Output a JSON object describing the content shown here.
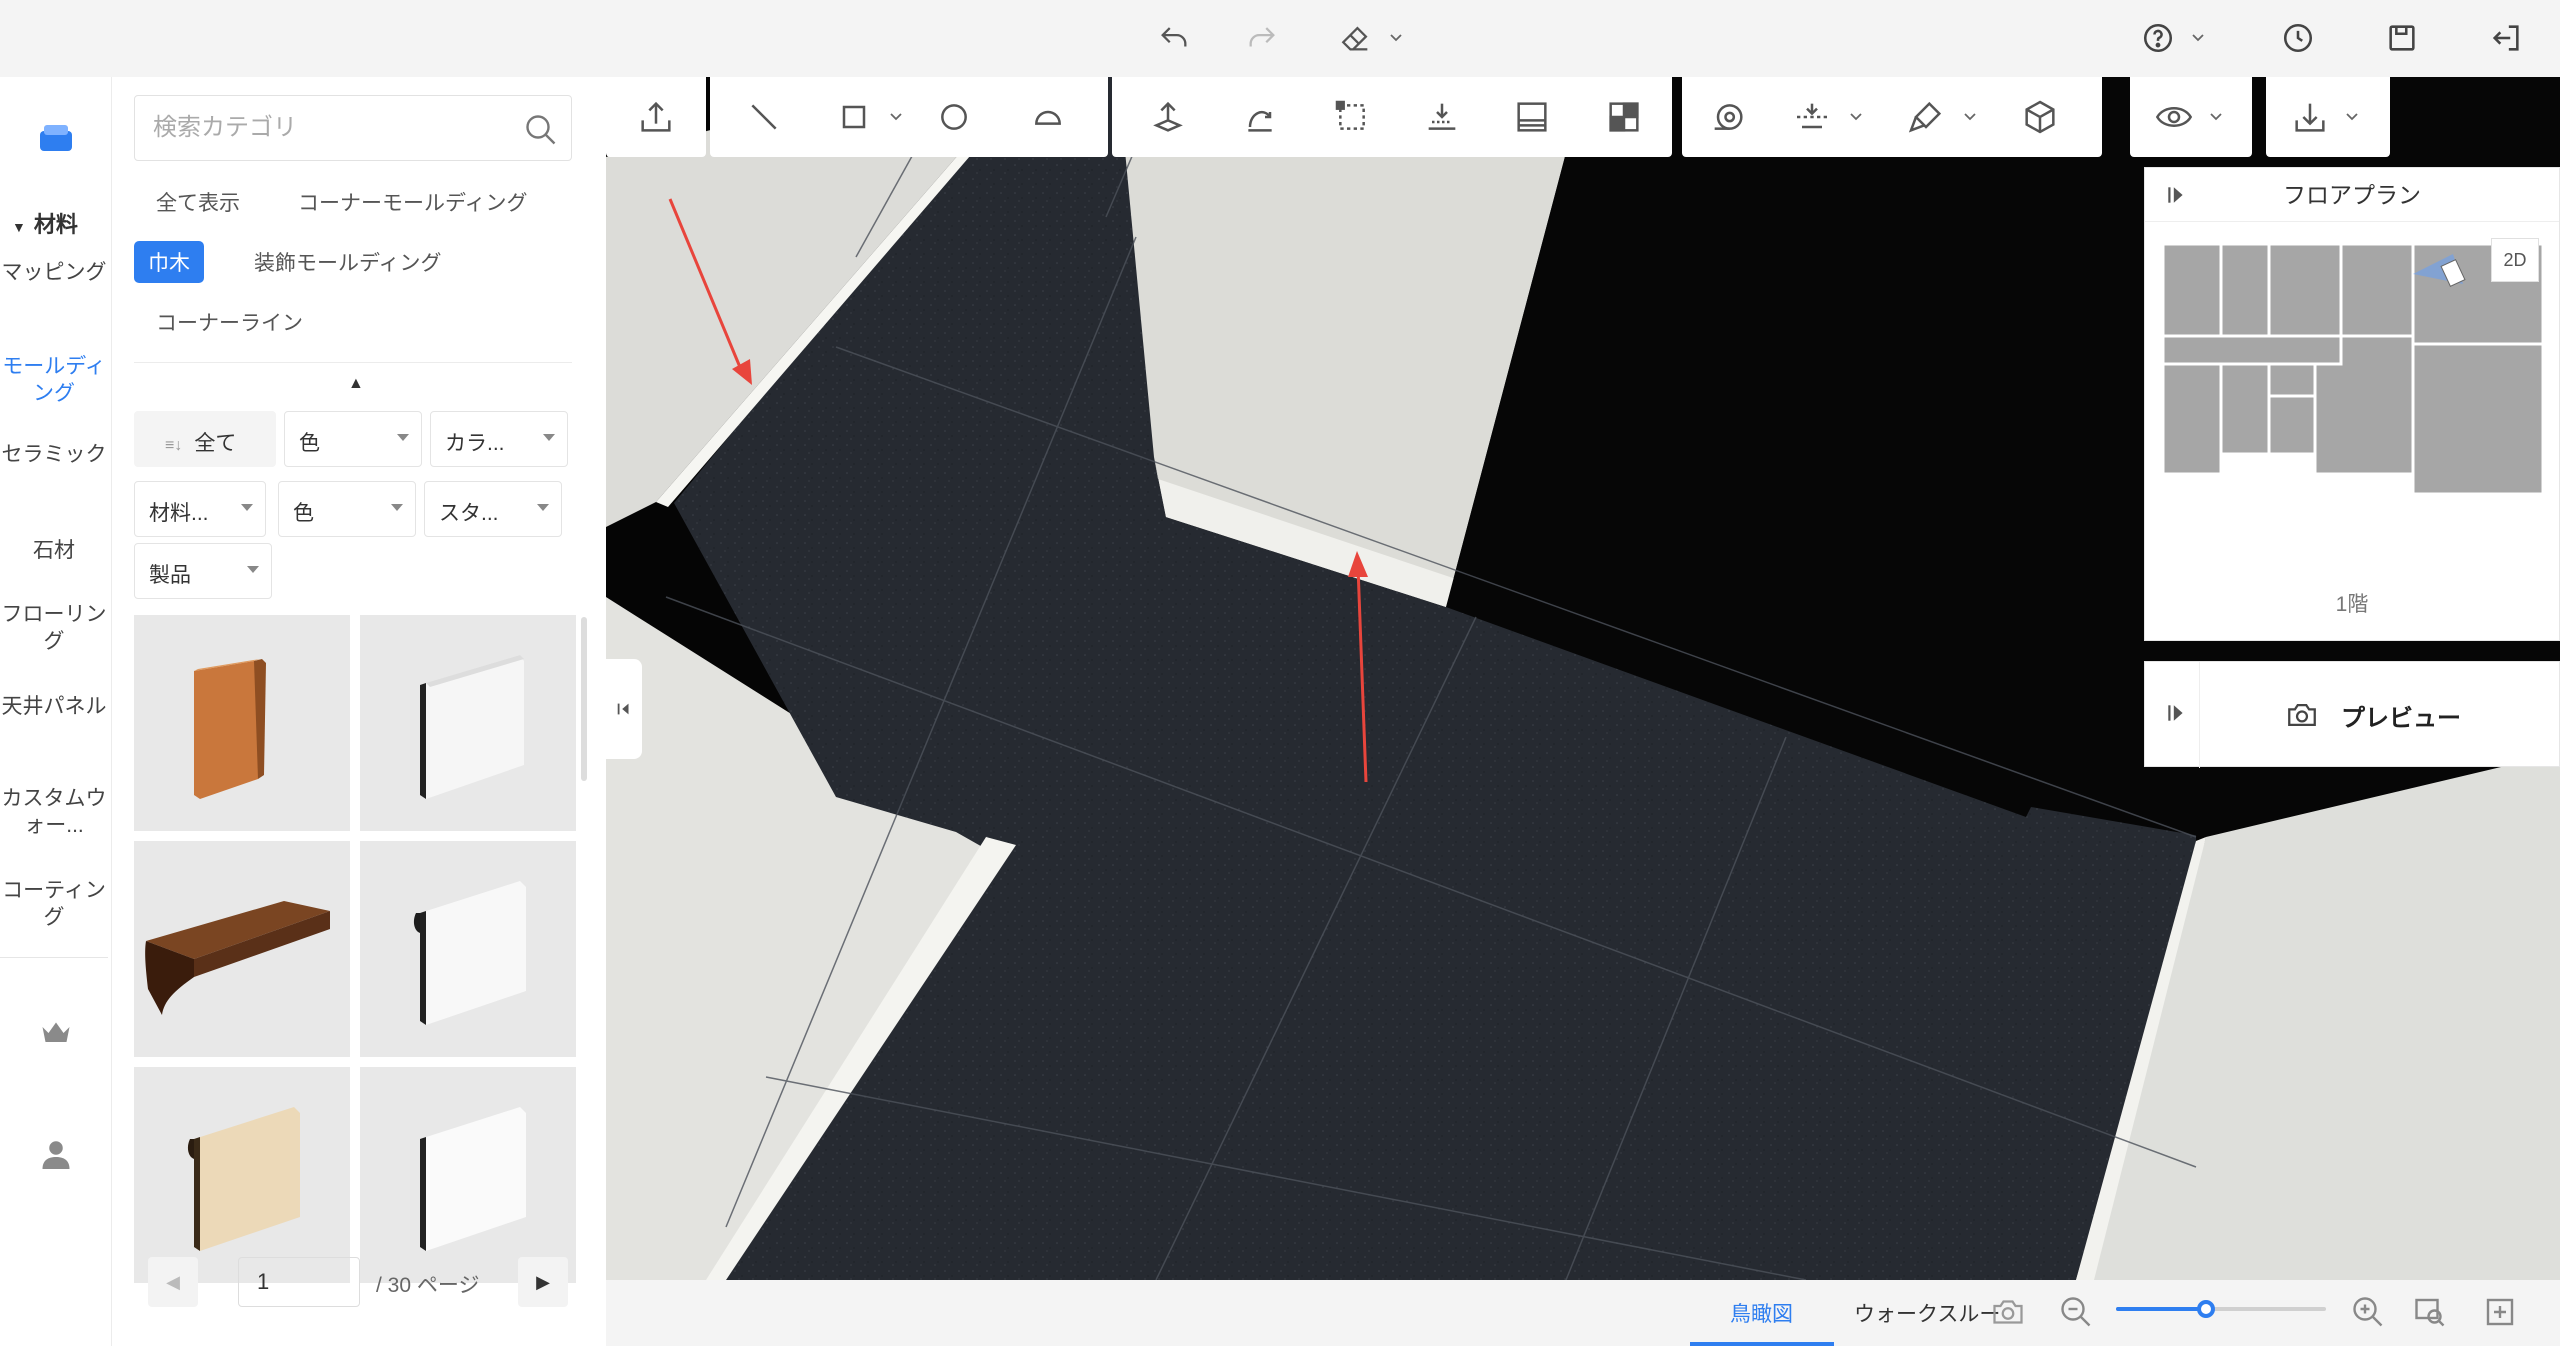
{
  "topbar": {
    "icons": [
      "undo-icon",
      "redo-icon",
      "eraser-icon",
      "help-icon",
      "history-icon",
      "save-icon",
      "exit-icon"
    ]
  },
  "rail": {
    "header": "材料",
    "items": [
      {
        "label": "マッピング"
      },
      {
        "label": "モールディング",
        "active": true
      },
      {
        "label": "セラミック"
      },
      {
        "label": "石材"
      },
      {
        "label": "フローリング"
      },
      {
        "label": "天井パネル"
      },
      {
        "label": "カスタムウォー..."
      },
      {
        "label": "コーティング"
      }
    ]
  },
  "catalog": {
    "search_placeholder": "検索カテゴリ",
    "categories": [
      {
        "label": "全て表示"
      },
      {
        "label": "コーナーモールディング"
      },
      {
        "label": "巾木",
        "selected": true
      },
      {
        "label": "装飾モールディング"
      },
      {
        "label": "コーナーライン"
      }
    ],
    "filters": [
      {
        "label": "全て"
      },
      {
        "label": "色"
      },
      {
        "label": "カラ..."
      },
      {
        "label": "材料..."
      },
      {
        "label": "色"
      },
      {
        "label": "スタ..."
      },
      {
        "label": "製品"
      }
    ],
    "items": [
      {
        "name": "wood-baseboard"
      },
      {
        "name": "white-baseboard"
      },
      {
        "name": "walnut-cornice"
      },
      {
        "name": "white-ogee-baseboard"
      },
      {
        "name": "light-wood-baseboard"
      },
      {
        "name": "white-flat-baseboard"
      }
    ],
    "pager": {
      "current": "1",
      "total_label": "/ 30 ページ",
      "prev": "◀",
      "next": "▶"
    }
  },
  "toolbar": {
    "tools": [
      "export-icon",
      "line-icon",
      "rectangle-icon",
      "circle-icon",
      "arc-icon",
      "lift-icon",
      "rotate-icon",
      "select-area-icon",
      "floor-level-icon",
      "panel-icon",
      "split-icon",
      "measure-icon",
      "align-icon",
      "paint-icon",
      "cube-icon",
      "eye-icon",
      "download-icon"
    ]
  },
  "floorplan": {
    "title": "フロアプラン",
    "mode": "2D",
    "floor_label": "1階"
  },
  "preview": {
    "label": "プレビュー"
  },
  "bottombar": {
    "tabs": [
      {
        "label": "鳥瞰図",
        "active": true
      },
      {
        "label": "ウォークスルー"
      }
    ],
    "zoom_level": 0.43
  },
  "colors": {
    "accent": "#2e7ef0",
    "annotation_arrow": "#e8453c"
  }
}
